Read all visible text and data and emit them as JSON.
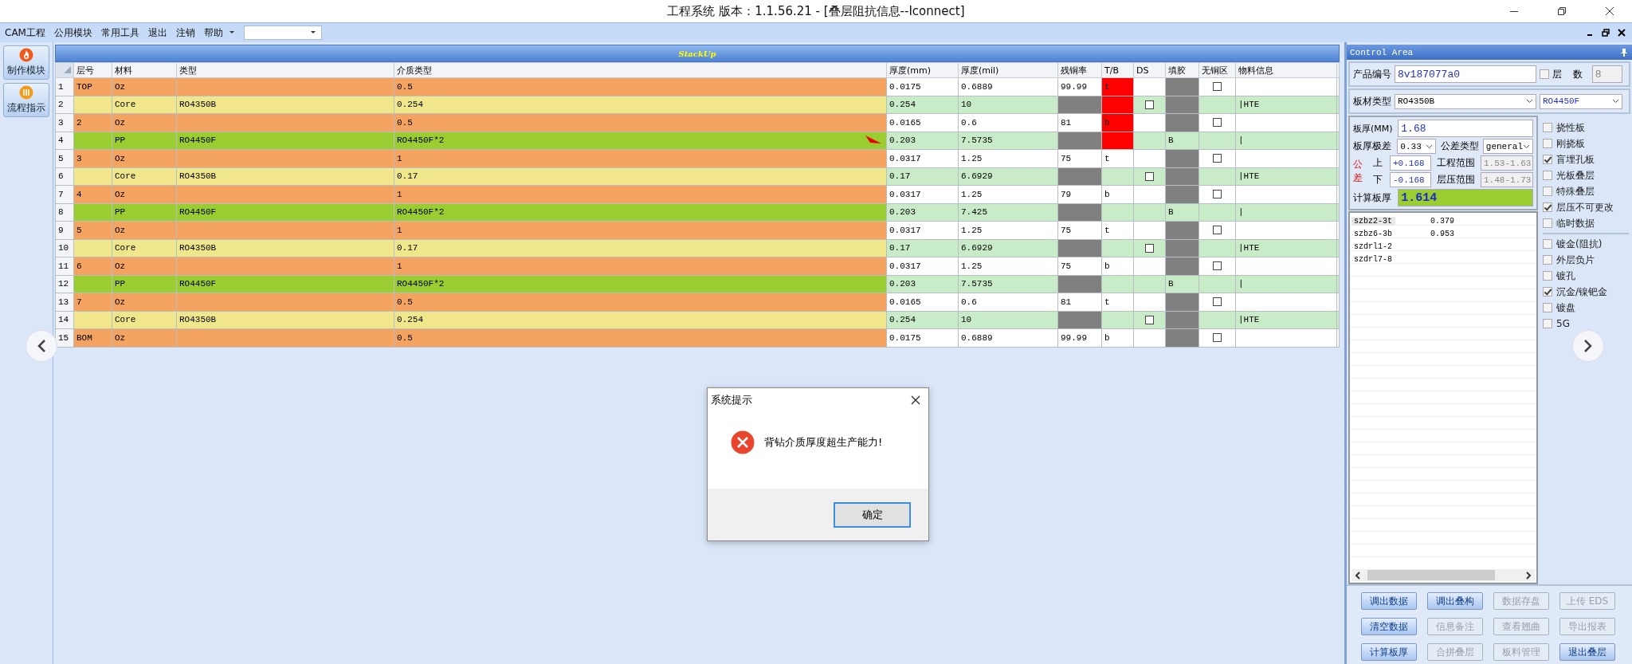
{
  "window": {
    "title": "工程系统  版本：1.1.56.21 - [叠层阻抗信息--Iconnect]"
  },
  "menu": {
    "items": [
      "CAM工程",
      "公用模块",
      "常用工具",
      "退出",
      "注销",
      "帮助"
    ]
  },
  "left_nav": [
    {
      "label": "制作模块"
    },
    {
      "label": "流程指示"
    }
  ],
  "stackup": {
    "title": "StackUp",
    "columns": [
      "层号",
      "材料",
      "类型",
      "介质类型",
      "厚度(mm)",
      "厚度(mil)",
      "残铜率",
      "T/B",
      "DS",
      "填胶",
      "无铜区",
      "物料信息"
    ],
    "rows": [
      {
        "no": "1",
        "kind": "oz",
        "layer": "TOP",
        "material": "Oz",
        "dielectric": "0.5",
        "mm": "0.0175",
        "mil": "0.6889",
        "copper": "99.99",
        "tb": "t",
        "tb_alert": true,
        "no_copper_checked": false,
        "marker": false
      },
      {
        "no": "2",
        "kind": "core",
        "material": "Core",
        "type": "RO4350B",
        "dielectric": "0.254",
        "mm": "0.254",
        "mil": "10",
        "tb_alert": true,
        "ds_checked": false,
        "info": "|HTE",
        "marker": false
      },
      {
        "no": "3",
        "kind": "oz",
        "layer": "2",
        "material": "Oz",
        "dielectric": "0.5",
        "mm": "0.0165",
        "mil": "0.6",
        "copper": "81",
        "tb": "b",
        "tb_alert": true,
        "no_copper_checked": false,
        "marker": false
      },
      {
        "no": "4",
        "kind": "pp",
        "material": "PP",
        "type": "RO4450F",
        "dielectric": "RO4450F*2",
        "mm": "0.203",
        "mil": "7.5735",
        "tb_alert": true,
        "fill": "B",
        "info": "|",
        "marker": true
      },
      {
        "no": "5",
        "kind": "oz",
        "layer": "3",
        "material": "Oz",
        "dielectric": "1",
        "mm": "0.0317",
        "mil": "1.25",
        "copper": "75",
        "tb": "t",
        "tb_alert": false,
        "no_copper_checked": false,
        "marker": false
      },
      {
        "no": "6",
        "kind": "core",
        "material": "Core",
        "type": "RO4350B",
        "dielectric": "0.17",
        "mm": "0.17",
        "mil": "6.6929",
        "tb_alert": false,
        "ds_checked": false,
        "info": "|HTE",
        "marker": false
      },
      {
        "no": "7",
        "kind": "oz",
        "layer": "4",
        "material": "Oz",
        "dielectric": "1",
        "mm": "0.0317",
        "mil": "1.25",
        "copper": "79",
        "tb": "b",
        "tb_alert": false,
        "no_copper_checked": false,
        "marker": false
      },
      {
        "no": "8",
        "kind": "pp",
        "material": "PP",
        "type": "RO4450F",
        "dielectric": "RO4450F*2",
        "mm": "0.203",
        "mil": "7.425",
        "tb_alert": false,
        "fill": "B",
        "info": "|",
        "marker": false
      },
      {
        "no": "9",
        "kind": "oz",
        "layer": "5",
        "material": "Oz",
        "dielectric": "1",
        "mm": "0.0317",
        "mil": "1.25",
        "copper": "75",
        "tb": "t",
        "tb_alert": false,
        "no_copper_checked": false,
        "marker": false
      },
      {
        "no": "10",
        "kind": "core",
        "material": "Core",
        "type": "RO4350B",
        "dielectric": "0.17",
        "mm": "0.17",
        "mil": "6.6929",
        "tb_alert": false,
        "ds_checked": false,
        "info": "|HTE",
        "marker": false
      },
      {
        "no": "11",
        "kind": "oz",
        "layer": "6",
        "material": "Oz",
        "dielectric": "1",
        "mm": "0.0317",
        "mil": "1.25",
        "copper": "75",
        "tb": "b",
        "tb_alert": false,
        "no_copper_checked": false,
        "marker": false
      },
      {
        "no": "12",
        "kind": "pp",
        "material": "PP",
        "type": "RO4450F",
        "dielectric": "RO4450F*2",
        "mm": "0.203",
        "mil": "7.5735",
        "tb_alert": false,
        "fill": "B",
        "info": "|",
        "marker": false
      },
      {
        "no": "13",
        "kind": "oz",
        "layer": "7",
        "material": "Oz",
        "dielectric": "0.5",
        "mm": "0.0165",
        "mil": "0.6",
        "copper": "81",
        "tb": "t",
        "tb_alert": false,
        "no_copper_checked": false,
        "marker": false
      },
      {
        "no": "14",
        "kind": "core",
        "material": "Core",
        "type": "RO4350B",
        "dielectric": "0.254",
        "mm": "0.254",
        "mil": "10",
        "tb_alert": false,
        "ds_checked": false,
        "info": "|HTE",
        "marker": false
      },
      {
        "no": "15",
        "kind": "oz",
        "layer": "BOM",
        "material": "Oz",
        "dielectric": "0.5",
        "mm": "0.0175",
        "mil": "0.6889",
        "copper": "99.99",
        "tb": "b",
        "tb_alert": false,
        "no_copper_checked": false,
        "marker": false
      }
    ]
  },
  "control_area": {
    "title": "Control Area",
    "product": {
      "label": "产品编号",
      "value": "8v187077a0"
    },
    "layer_count": {
      "label": "层 数",
      "checked": false,
      "value": "8"
    },
    "material": {
      "label": "板材类型",
      "core": "RO4350B",
      "pp": "RO4450F"
    },
    "thickness": {
      "label": "板厚(MM)",
      "value": "1.68"
    },
    "range": {
      "label": "板厚极差",
      "value": "0.33"
    },
    "tolerance_type": {
      "label": "公差类型",
      "value": "general"
    },
    "tolerance": {
      "label": "公差",
      "upper_label": "上",
      "upper": "+0.168",
      "lower_label": "下",
      "lower": "-0.168"
    },
    "eng_range": {
      "label": "工程范围",
      "value": "1.53-1.63"
    },
    "press_range": {
      "label": "层压范围",
      "value": "1.48-1.73"
    },
    "calc": {
      "label": "计算板厚",
      "value": "1.614"
    },
    "list_rows": [
      {
        "name": "szbz2-3t",
        "value": "0.379",
        "selected": true
      },
      {
        "name": "szbz6-3b",
        "value": "0.953",
        "selected": false
      },
      {
        "name": "szdrl1-2",
        "selected": false
      },
      {
        "name": "szdrl7-8",
        "selected": false
      }
    ],
    "options": [
      {
        "label": "挠性板",
        "checked": false
      },
      {
        "label": "刚挠板",
        "checked": false
      },
      {
        "label": "盲埋孔板",
        "checked": true
      },
      {
        "label": "光板叠层",
        "checked": false
      },
      {
        "label": "特殊叠层",
        "checked": false
      },
      {
        "label": "层压不可更改",
        "checked": true
      },
      {
        "label": "临时数据",
        "checked": false
      }
    ],
    "options_2": [
      {
        "label": "镀金(阻抗)",
        "checked": false
      },
      {
        "label": "外层负片",
        "checked": false
      },
      {
        "label": "镀孔",
        "checked": false
      },
      {
        "label": "沉金/镍钯金",
        "checked": true
      },
      {
        "label": "镀盘",
        "checked": false
      },
      {
        "label": "5G",
        "checked": false
      }
    ],
    "buttons": [
      {
        "label": "调出数据",
        "disabled": false
      },
      {
        "label": "调出叠构",
        "disabled": false
      },
      {
        "label": "数据存盘",
        "disabled": true
      },
      {
        "label": "上传 EDS",
        "disabled": true
      },
      {
        "label": "清空数据",
        "disabled": false
      },
      {
        "label": "信息备注",
        "disabled": true
      },
      {
        "label": "查看翘曲",
        "disabled": true
      },
      {
        "label": "导出报表",
        "disabled": true
      },
      {
        "label": "计算板厚",
        "disabled": false
      },
      {
        "label": "合拼叠层",
        "disabled": true
      },
      {
        "label": "板料管理",
        "disabled": true
      },
      {
        "label": "退出叠层",
        "disabled": false
      }
    ]
  },
  "dialog": {
    "title": "系统提示",
    "message": "背钻介质厚度超生产能力!",
    "button": "确定"
  }
}
